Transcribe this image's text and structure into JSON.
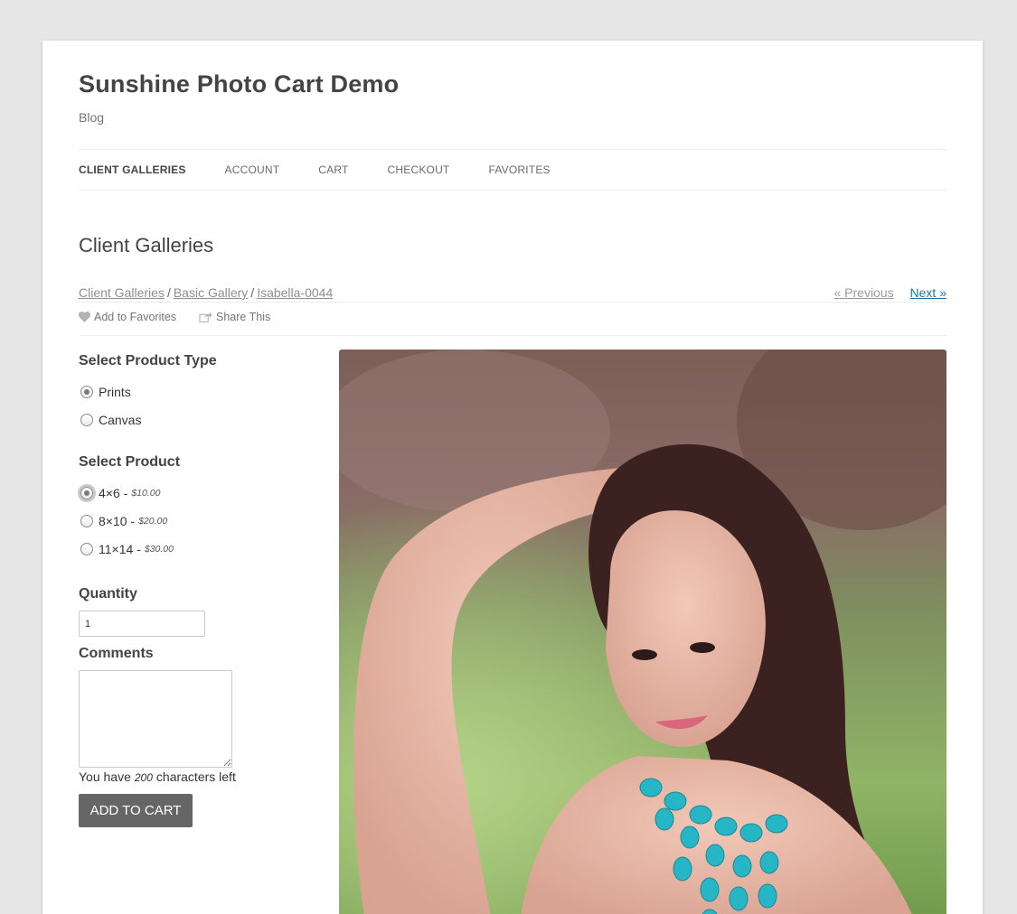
{
  "site": {
    "title": "Sunshine Photo Cart Demo",
    "description": "Blog"
  },
  "nav": {
    "items": [
      {
        "label": "CLIENT GALLERIES",
        "current": true
      },
      {
        "label": "ACCOUNT"
      },
      {
        "label": "CART"
      },
      {
        "label": "CHECKOUT"
      },
      {
        "label": "FAVORITES"
      }
    ]
  },
  "page": {
    "title": "Client Galleries"
  },
  "breadcrumb": {
    "items": [
      "Client Galleries",
      "Basic Gallery",
      "Isabella-0044"
    ],
    "separator": "/"
  },
  "pager": {
    "previous": "« Previous",
    "next": "Next »"
  },
  "actions": {
    "favorite": "Add to Favorites",
    "share": "Share This"
  },
  "form": {
    "product_type_heading": "Select Product Type",
    "product_types": [
      {
        "label": "Prints",
        "selected": true
      },
      {
        "label": "Canvas",
        "selected": false
      }
    ],
    "product_heading": "Select Product",
    "products": [
      {
        "label": "4×6 -",
        "price": "$10.00",
        "selected": true
      },
      {
        "label": "8×10 -",
        "price": "$20.00",
        "selected": false
      },
      {
        "label": "11×14 -",
        "price": "$30.00",
        "selected": false
      }
    ],
    "quantity_heading": "Quantity",
    "quantity_value": "1",
    "comments_heading": "Comments",
    "comments_value": "",
    "chars_prefix": "You have",
    "chars_count": "200",
    "chars_suffix": "characters left",
    "add_to_cart": "ADD TO CART"
  },
  "colors": {
    "accent_link": "#21759b",
    "button_bg": "#666666",
    "page_bg": "#e6e6e6"
  },
  "photo": {
    "icon": "portrait-photo"
  }
}
